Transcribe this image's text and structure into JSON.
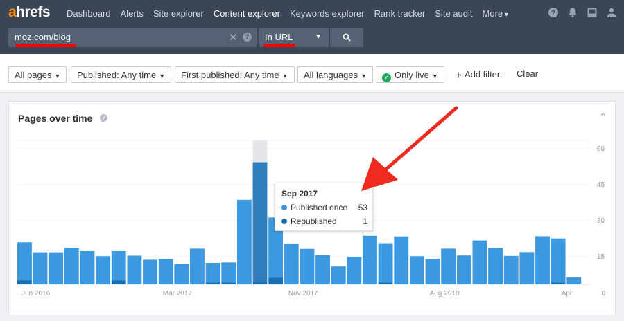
{
  "logo": {
    "a": "a",
    "rest": "hrefs"
  },
  "nav": {
    "items": [
      "Dashboard",
      "Alerts",
      "Site explorer",
      "Content explorer",
      "Keywords explorer",
      "Rank tracker",
      "Site audit"
    ],
    "more": "More"
  },
  "search": {
    "value": "moz.com/blog",
    "mode": "In URL"
  },
  "filters": {
    "all_pages": "All pages",
    "published": "Published: Any time",
    "first_published": "First published: Any time",
    "languages": "All languages",
    "only_live": "Only live",
    "add_filter": "Add filter",
    "clear": "Clear"
  },
  "panel": {
    "title": "Pages over time"
  },
  "tooltip": {
    "title": "Sep 2017",
    "rows": [
      {
        "label": "Published once",
        "value": "53",
        "color": "#3b99e0"
      },
      {
        "label": "Republished",
        "value": "1",
        "color": "#1a6fb0"
      }
    ]
  },
  "chart_data": {
    "type": "bar",
    "stacked": true,
    "x_tick_labels": [
      "Jun 2016",
      "Mar 2017",
      "Nov 2017",
      "Aug 2018",
      "Apr"
    ],
    "y_tick_labels": [
      "60",
      "45",
      "30",
      "15",
      "0"
    ],
    "ylim": [
      0,
      60
    ],
    "highlighted_index": 15,
    "series": [
      {
        "name": "Published once",
        "color": "#3b99e0",
        "values": [
          16.8,
          14,
          14,
          16,
          14.5,
          12.3,
          12.9,
          12.5,
          10.7,
          11,
          8.7,
          15.6,
          8.7,
          8.9,
          37.2,
          53,
          26.7,
          17.9,
          15.5,
          12.8,
          7.7,
          12,
          21.3,
          17.4,
          21,
          12.3,
          11.1,
          15.6,
          12.6,
          19.2,
          15.9,
          12.4,
          14.1,
          21.1,
          19.5,
          2.9
        ],
        "color_highlight": "#2f7dbd"
      },
      {
        "name": "Republished",
        "color": "#1a6fb0",
        "values": [
          1.8,
          0.2,
          0.2,
          0.2,
          0.2,
          0.2,
          1.8,
          0.2,
          0.2,
          0.2,
          0.2,
          0.2,
          0.8,
          0.8,
          0.2,
          1,
          2.9,
          0.2,
          0.2,
          0.2,
          0.2,
          0.2,
          0.2,
          0.8,
          0.2,
          0.2,
          0.2,
          0.2,
          0.2,
          0.2,
          0.2,
          0.2,
          0.2,
          0.2,
          0.8,
          0.2
        ]
      }
    ]
  },
  "colors": {
    "accent_red": "#f00",
    "bar": "#3b99e0",
    "bar_dark": "#1a6fb0",
    "nav_bg": "#3a4556"
  }
}
